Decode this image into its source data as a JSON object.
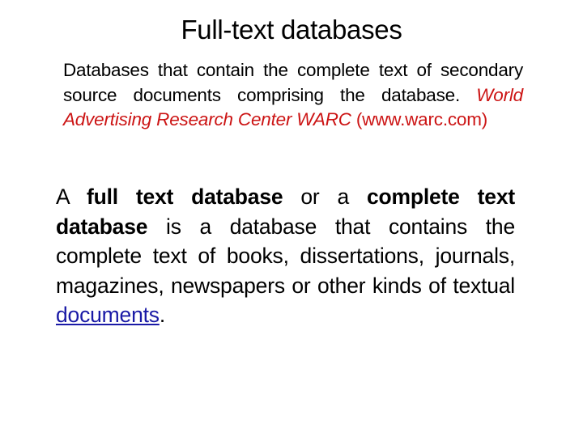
{
  "slide": {
    "title": "Full-text databases",
    "paragraph1": {
      "text_a": "Databases that contain the complete text of secondary source documents comprising the database. ",
      "red_italic": "World Advertising Research Center WARC",
      "red_plain": " (www.warc.com)",
      "accent_color": "#cc1414"
    },
    "paragraph2": {
      "t1": "A ",
      "b1": "full text database",
      "t2": " or a ",
      "b2": "complete text database",
      "t3": " is a database that contains the complete text of books, dissertations, journals, magazines, newspapers or other kinds of textual ",
      "link": "documents",
      "t4": ".",
      "link_color": "#1a1aa6"
    }
  }
}
